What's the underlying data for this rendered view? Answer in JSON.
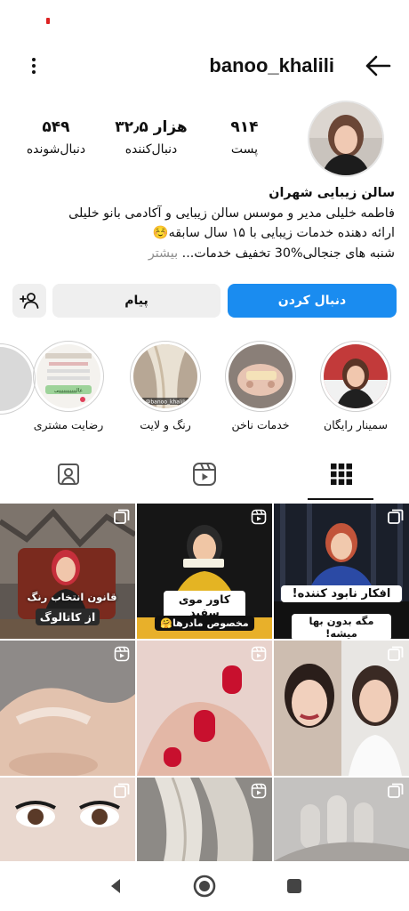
{
  "profile": {
    "username": "banoo_khalili",
    "stats": {
      "posts_value": "۹۱۴",
      "posts_label": "پست",
      "followers_value": "۳۲٫۵ هزار",
      "followers_label": "دنبال‌کننده",
      "following_value": "۵۴۹",
      "following_label": "دنبال‌شونده"
    },
    "bio": {
      "name": "سالن زیبایی شهران",
      "line1": "فاطمه خلیلی مدیر  و موسس سالن زیبایی و آکادمی بانو خلیلی",
      "line2": "ارائه دهنده  خدمات زیبایی با ۱۵ سال سابقه☺️",
      "line3": "شنبه های جنجالی%30 تخفیف خدمات...",
      "more": "بیشتر"
    }
  },
  "actions": {
    "follow_label": "دنبال کردن",
    "message_label": "پیام"
  },
  "highlights": [
    {
      "label": "سمینار رایگان"
    },
    {
      "label": "خدمات ناخن"
    },
    {
      "label": "رنگ و لایت"
    },
    {
      "label": "رضایت مشتری"
    }
  ],
  "highlight_image_text": {
    "color_light_watermark": "@banoo_khalili",
    "review_line": "عالیییییییییییی"
  },
  "grid_captions": {
    "post1_line1": "قانون انتخاب رنگ",
    "post1_line2": "از کاتالوگ",
    "post2_line1": "کاور موی سفید",
    "post2_line2": "مخصوص مادرها🤗",
    "post3_line1": "افکار نابود کننده!",
    "post3_line2": "مگه بدون بها میشه!"
  },
  "colors": {
    "accent_blue": "#1a8cf0",
    "button_gray": "#efefef",
    "text_dark": "#111111",
    "text_muted": "#8e8e8e"
  },
  "icons": {
    "back": "arrow-left-icon",
    "menu": "kebab-menu-icon",
    "add_user": "add-person-icon",
    "grid_tab": "grid-icon",
    "reels_tab": "reels-icon",
    "tagged_tab": "tagged-person-icon",
    "carousel": "multiple-posts-icon",
    "reel": "reel-badge-icon"
  }
}
